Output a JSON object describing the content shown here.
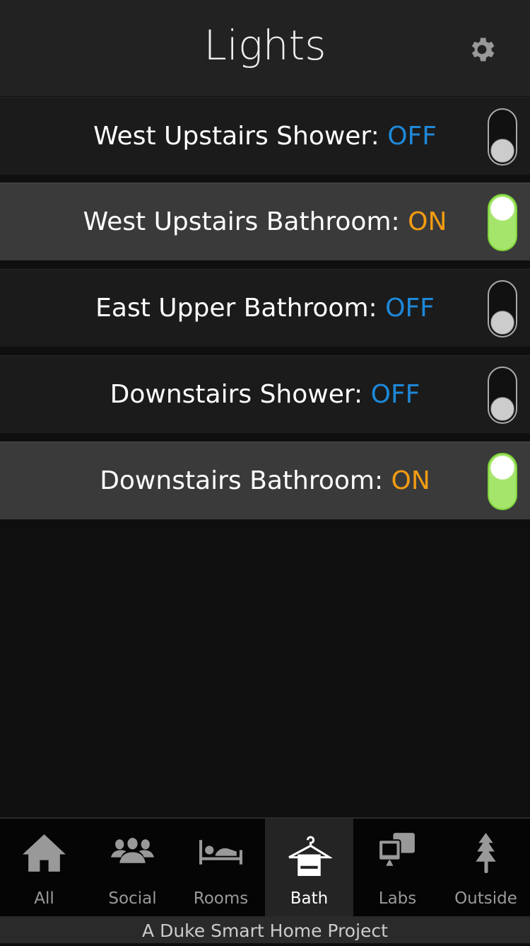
{
  "header": {
    "title": "Lights",
    "settings_icon": "gear-icon"
  },
  "lights": [
    {
      "name": "West Upstairs Shower:",
      "state": "OFF"
    },
    {
      "name": "West Upstairs Bathroom:",
      "state": "ON"
    },
    {
      "name": "East Upper Bathroom:",
      "state": "OFF"
    },
    {
      "name": "Downstairs Shower:",
      "state": "OFF"
    },
    {
      "name": "Downstairs Bathroom:",
      "state": "ON"
    }
  ],
  "nav": [
    {
      "label": "All",
      "icon": "home-icon"
    },
    {
      "label": "Social",
      "icon": "people-icon"
    },
    {
      "label": "Rooms",
      "icon": "bed-icon"
    },
    {
      "label": "Bath",
      "icon": "hanger-towel-icon",
      "active": true
    },
    {
      "label": "Labs",
      "icon": "computers-icon"
    },
    {
      "label": "Outside",
      "icon": "tree-icon"
    }
  ],
  "footer": "A Duke Smart Home Project",
  "colors": {
    "off": "#1e88d8",
    "on": "#f39c12",
    "toggle_on": "#a5e56b"
  }
}
